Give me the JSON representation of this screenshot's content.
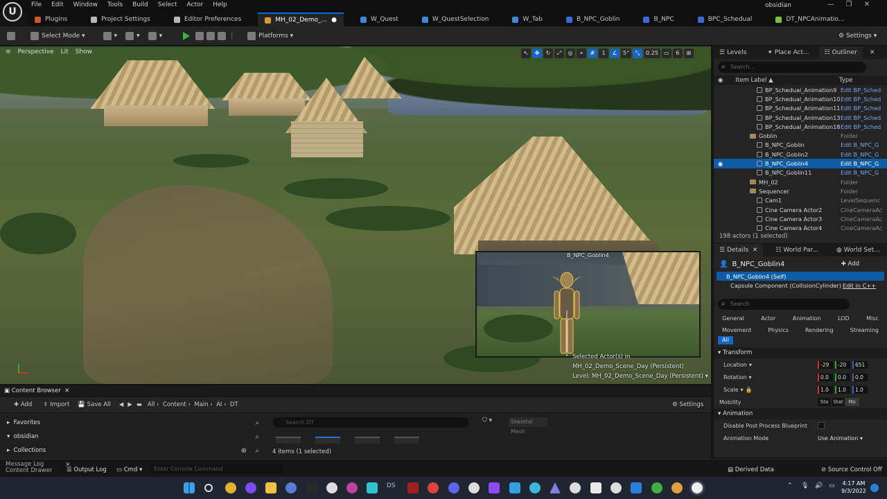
{
  "menu": {
    "items": [
      "File",
      "Edit",
      "Window",
      "Tools",
      "Build",
      "Select",
      "Actor",
      "Help"
    ],
    "user": "obsidian"
  },
  "window_controls": [
    "—",
    "❐",
    "✕"
  ],
  "tabs": [
    {
      "label": "Plugins",
      "color": "#c95a2a"
    },
    {
      "label": "Project Settings",
      "color": "#b8b8b8"
    },
    {
      "label": "Editor Preferences",
      "color": "#b8b8b8"
    },
    {
      "label": "MH_02_Demo_...",
      "color": "#d89a30",
      "active": true
    },
    {
      "label": "W_Quest",
      "color": "#3a8ad8"
    },
    {
      "label": "W_QuestSelection",
      "color": "#3a8ad8"
    },
    {
      "label": "W_Tab",
      "color": "#3a8ad8"
    },
    {
      "label": "B_NPC_Goblin",
      "color": "#3a6ad8"
    },
    {
      "label": "B_NPC",
      "color": "#3a6ad8"
    },
    {
      "label": "BPC_Schedual",
      "color": "#3a6ad8"
    },
    {
      "label": "DT_NPCAnimatio...",
      "color": "#7ac040"
    }
  ],
  "toolbar": {
    "select_mode": "Select Mode",
    "platforms": "Platforms",
    "settings": "Settings"
  },
  "viewport": {
    "perspective": "Perspective",
    "lit": "Lit",
    "show": "Show",
    "angle": "5°",
    "scale": "0.25",
    "cam": "6",
    "grid": "1",
    "preview_label": "B_NPC_Goblin4",
    "selected_info_1": "Selected Actor(s) in",
    "selected_info_2": "MH_02_Demo_Scene_Day (Persistent)",
    "selected_info_3": "Level: MH_02_Demo_Scene_Day (Persistent)"
  },
  "outliner": {
    "tabs": [
      "Levels",
      "Place Act...",
      "Outliner"
    ],
    "search_placeholder": "Search...",
    "col_label": "Item Label ▲",
    "col_type": "Type",
    "rows": [
      {
        "indent": 62,
        "name": "BP_Schedual_Animation9",
        "type": "Edit BP_Sched"
      },
      {
        "indent": 62,
        "name": "BP_Schedual_Animation10",
        "type": "Edit BP_Sched"
      },
      {
        "indent": 62,
        "name": "BP_Schedual_Animation11",
        "type": "Edit BP_Sched"
      },
      {
        "indent": 62,
        "name": "BP_Schedual_Animation13",
        "type": "Edit BP_Sched"
      },
      {
        "indent": 62,
        "name": "BP_Schedual_Animation18",
        "type": "Edit BP_Sched"
      },
      {
        "indent": 52,
        "name": "Goblin",
        "type": "Folder",
        "folder": true
      },
      {
        "indent": 62,
        "name": "B_NPC_Goblin",
        "type": "Edit B_NPC_G"
      },
      {
        "indent": 62,
        "name": "B_NPC_Goblin2",
        "type": "Edit B_NPC_G"
      },
      {
        "indent": 62,
        "name": "B_NPC_Goblin4",
        "type": "Edit B_NPC_G",
        "selected": true
      },
      {
        "indent": 62,
        "name": "B_NPC_Goblin11",
        "type": "Edit B_NPC_G"
      },
      {
        "indent": 52,
        "name": "MH_02",
        "type": "Folder",
        "folder": true
      },
      {
        "indent": 52,
        "name": "Sequencer",
        "type": "Folder",
        "folder": true
      },
      {
        "indent": 62,
        "name": "Cam1",
        "type": "LevelSequenc"
      },
      {
        "indent": 62,
        "name": "Cine Camera Actor2",
        "type": "CineCameraAc"
      },
      {
        "indent": 62,
        "name": "Cine Camera Actor3",
        "type": "CineCameraAc"
      },
      {
        "indent": 62,
        "name": "Cine Camera Actor4",
        "type": "CineCameraAc"
      }
    ],
    "actor_count": "198 actors (1 selected)"
  },
  "details": {
    "tabs": [
      "Details",
      "World Par...",
      "World Set..."
    ],
    "title": "B_NPC_Goblin4",
    "add_label": "Add",
    "self_row": "B_NPC_Goblin4 (Self)",
    "component": "Capsule Component (CollisionCylinder)",
    "edit_cpp": "Edit in C++",
    "search_placeholder": "Search",
    "categories_1": [
      "General",
      "Actor",
      "Animation",
      "LOD",
      "Misc"
    ],
    "categories_2": [
      "Movement",
      "Physics",
      "Rendering",
      "Streaming"
    ],
    "cat_all": "All",
    "transform": "Transform",
    "location": {
      "label": "Location",
      "x": "-29",
      "y": "-20",
      "z": "651"
    },
    "rotation": {
      "label": "Rotation",
      "x": "0.0",
      "y": "0.0",
      "z": "0.0"
    },
    "scale": {
      "label": "Scale",
      "x": "1.0",
      "y": "1.0",
      "z": "1.0"
    },
    "mobility": {
      "label": "Mobility",
      "options": [
        "Sta",
        "Stat",
        "Mo"
      ]
    },
    "animation": "Animation",
    "disable_pp": "Disable Post Process Blueprint",
    "anim_mode": {
      "label": "Animation Mode",
      "value": "Use Animation"
    }
  },
  "content_browser": {
    "tab": "Content Browser",
    "add": "Add",
    "import": "Import",
    "save_all": "Save All",
    "path": [
      "All",
      "Content",
      "Main",
      "AI",
      "DT"
    ],
    "settings": "Settings",
    "left_rows": [
      "Favorites",
      "obsidian",
      "Collections"
    ],
    "search_placeholder": "Search DT",
    "filter_chip": "Skeletal Mesh",
    "items_count": "4 items (1 selected)"
  },
  "statusbar": {
    "content_drawer": "Content Drawer",
    "message_log": "Message Log",
    "output_log": "Output Log",
    "cmd": "Cmd",
    "cmd_placeholder": "Enter Console Command",
    "derived_data": "Derived Data",
    "source_control": "Source Control Off"
  },
  "taskbar": {
    "time": "4:17 AM",
    "date": "9/3/2022"
  }
}
